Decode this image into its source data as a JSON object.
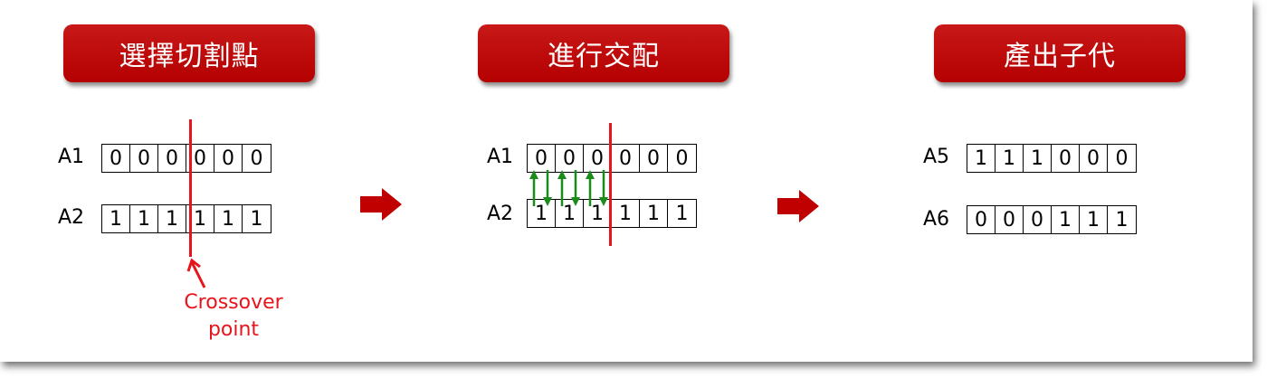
{
  "steps": [
    {
      "title": "選擇切割點"
    },
    {
      "title": "進行交配"
    },
    {
      "title": "產出子代"
    }
  ],
  "panel1": {
    "rows": [
      {
        "label": "A1",
        "bits": [
          "0",
          "0",
          "0",
          "0",
          "0",
          "0"
        ]
      },
      {
        "label": "A2",
        "bits": [
          "1",
          "1",
          "1",
          "1",
          "1",
          "1"
        ]
      }
    ],
    "annotation_line1": "Crossover",
    "annotation_line2": "point"
  },
  "panel2": {
    "rows": [
      {
        "label": "A1",
        "bits": [
          "0",
          "0",
          "0",
          "0",
          "0",
          "0"
        ]
      },
      {
        "label": "A2",
        "bits": [
          "1",
          "1",
          "1",
          "1",
          "1",
          "1"
        ]
      }
    ]
  },
  "panel3": {
    "rows": [
      {
        "label": "A5",
        "bits": [
          "1",
          "1",
          "1",
          "0",
          "0",
          "0"
        ]
      },
      {
        "label": "A6",
        "bits": [
          "0",
          "0",
          "0",
          "1",
          "1",
          "1"
        ]
      }
    ]
  },
  "colors": {
    "header_red": "#b40000",
    "cut_line": "#e8141c",
    "swap_arrows": "#1a8c1a",
    "step_arrow": "#c00000"
  }
}
